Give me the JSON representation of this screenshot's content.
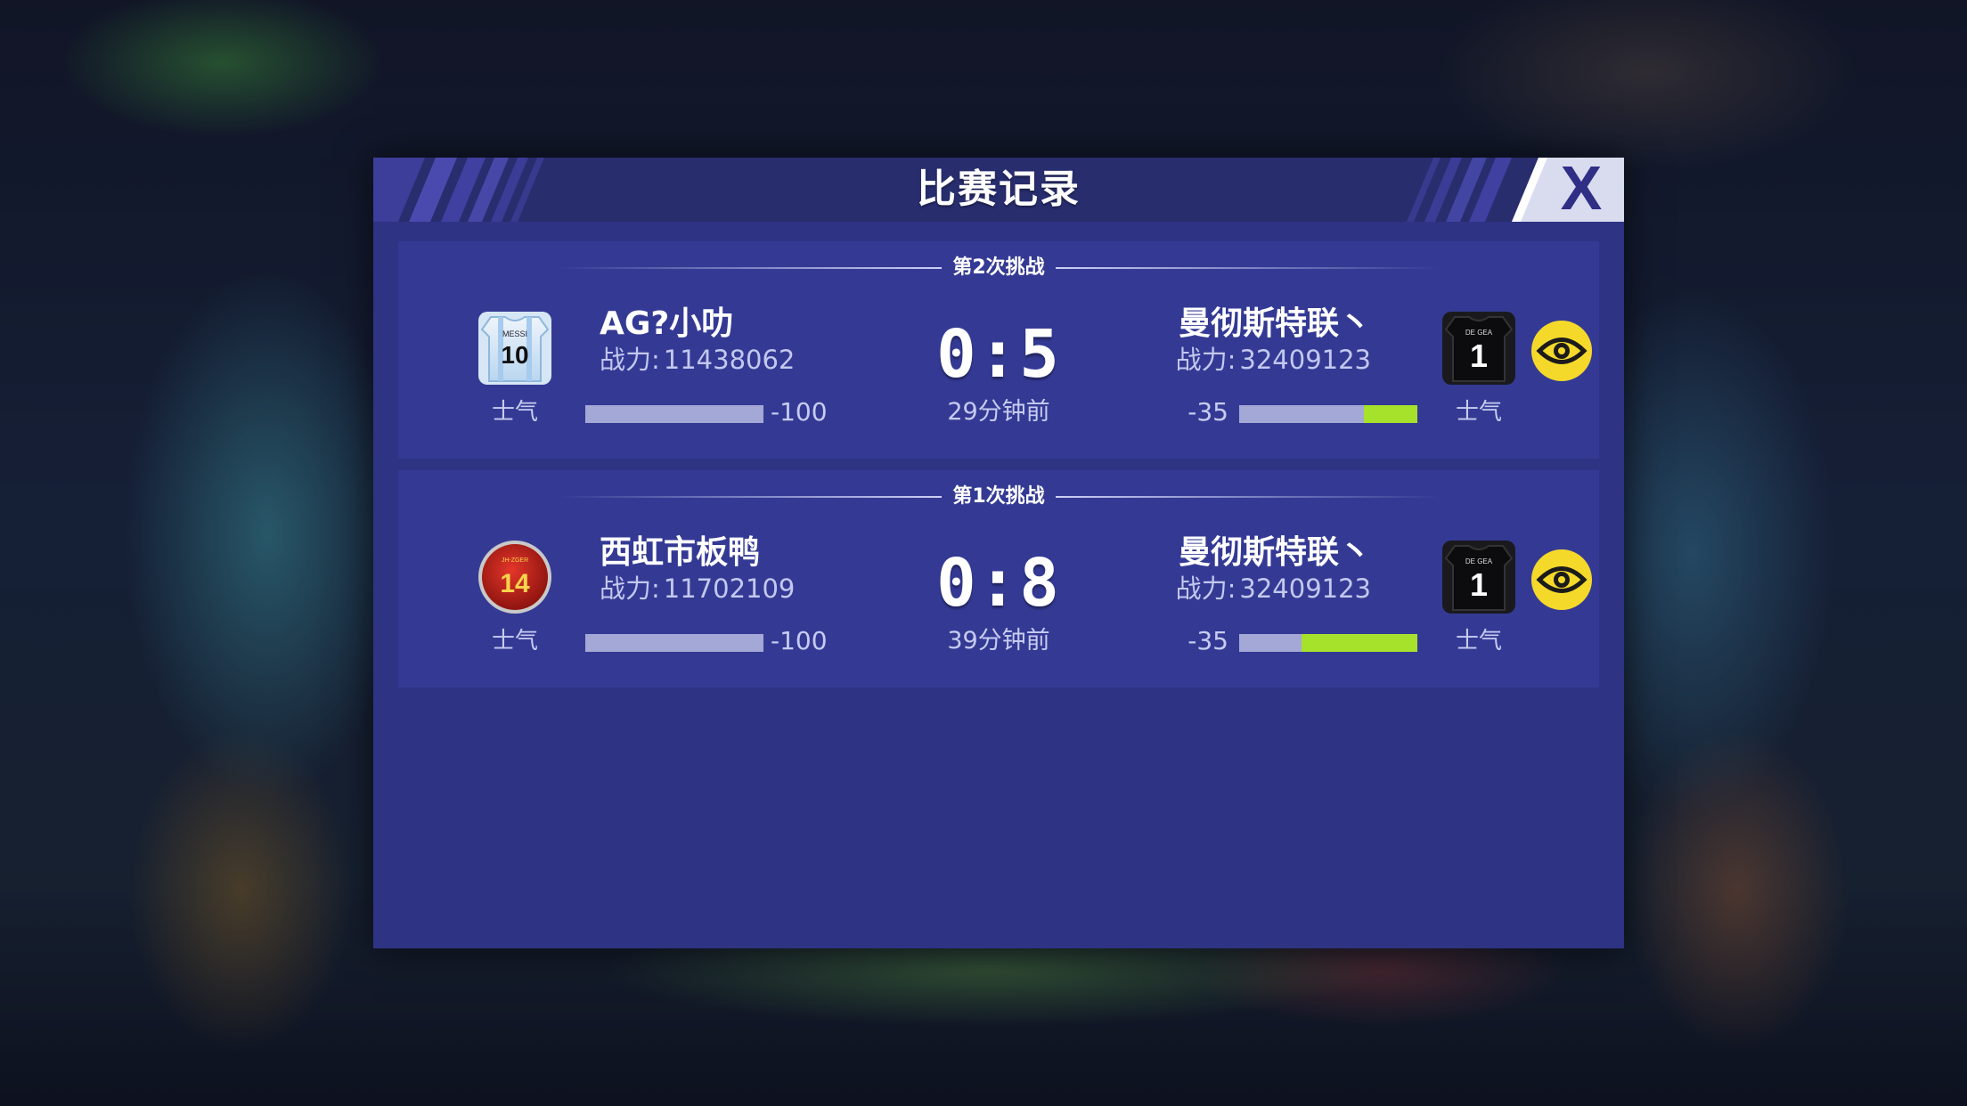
{
  "dialog": {
    "title": "比赛记录",
    "close_label": "X"
  },
  "records": [
    {
      "label": "第2次挑战",
      "left": {
        "name": "AG?小叻",
        "power_label": "战力:",
        "power": "11438062",
        "morale_label": "士气",
        "morale_value": "-100",
        "jersey_number": "10",
        "jersey_name": "MESSI"
      },
      "score": "0:5",
      "time": "29分钟前",
      "right": {
        "name": "曼彻斯特联丶",
        "power_label": "战力:",
        "power": "32409123",
        "morale_label": "士气",
        "morale_value": "-35",
        "morale_fill": 0.3,
        "jersey_number": "1",
        "jersey_name": "DE GEA"
      }
    },
    {
      "label": "第1次挑战",
      "left": {
        "name": "西虹市板鸭",
        "power_label": "战力:",
        "power": "11702109",
        "morale_label": "士气",
        "morale_value": "-100",
        "jersey_number": "14",
        "jersey_name": "JH-ZGER"
      },
      "score": "0:8",
      "time": "39分钟前",
      "right": {
        "name": "曼彻斯特联丶",
        "power_label": "战力:",
        "power": "32409123",
        "morale_label": "士气",
        "morale_value": "-35",
        "morale_fill": 0.65,
        "jersey_number": "1",
        "jersey_name": "DE GEA"
      }
    }
  ],
  "icons": {
    "view_replay": "eye-icon",
    "close": "close-icon"
  },
  "colors": {
    "panel": "#2e3384",
    "card": "#343a94",
    "morale_fill": "#a6e12c",
    "eye_button": "#f5d92a"
  }
}
